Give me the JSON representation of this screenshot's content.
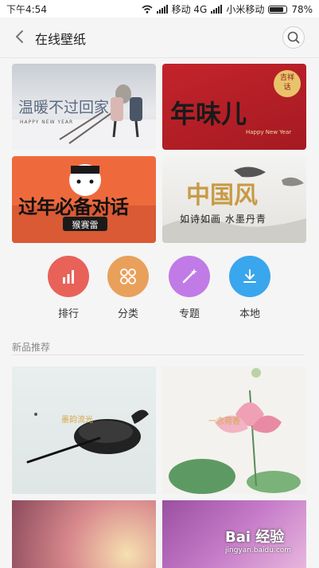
{
  "status_bar": {
    "time": "下午4:54",
    "carrier1": "移动 4G",
    "carrier2": "小米移动",
    "battery": "78%",
    "battery_level": 0.78
  },
  "header": {
    "title": "在线壁纸",
    "back_icon": "back-arrow-icon",
    "search_icon": "search-icon"
  },
  "banners": [
    {
      "text": "温暖不过回家",
      "sub": "HAPPY NEW YEAR"
    },
    {
      "text": "年味儿",
      "badge": "吉祥话",
      "sub": "Happy New Year"
    },
    {
      "text": "过年必备对话",
      "badge": "猴赛雷"
    },
    {
      "text": "中国风",
      "sub": "如诗如画 水墨丹青"
    }
  ],
  "categories": [
    {
      "label": "排行",
      "icon": "bar-chart-icon",
      "color": "#e86259"
    },
    {
      "label": "分类",
      "icon": "grid-circles-icon",
      "color": "#e9a05a"
    },
    {
      "label": "专题",
      "icon": "magic-wand-icon",
      "color": "#c17be6"
    },
    {
      "label": "本地",
      "icon": "download-icon",
      "color": "#3aa6ee"
    }
  ],
  "section": {
    "title": "新品推荐"
  },
  "wallpapers": [
    {
      "text": "墨韵流光"
    },
    {
      "text": "一念荷香"
    },
    {
      "text": ""
    },
    {
      "text": ""
    }
  ],
  "watermark": {
    "text": "Bai 经验",
    "url": "jingyan.baidu.com"
  }
}
